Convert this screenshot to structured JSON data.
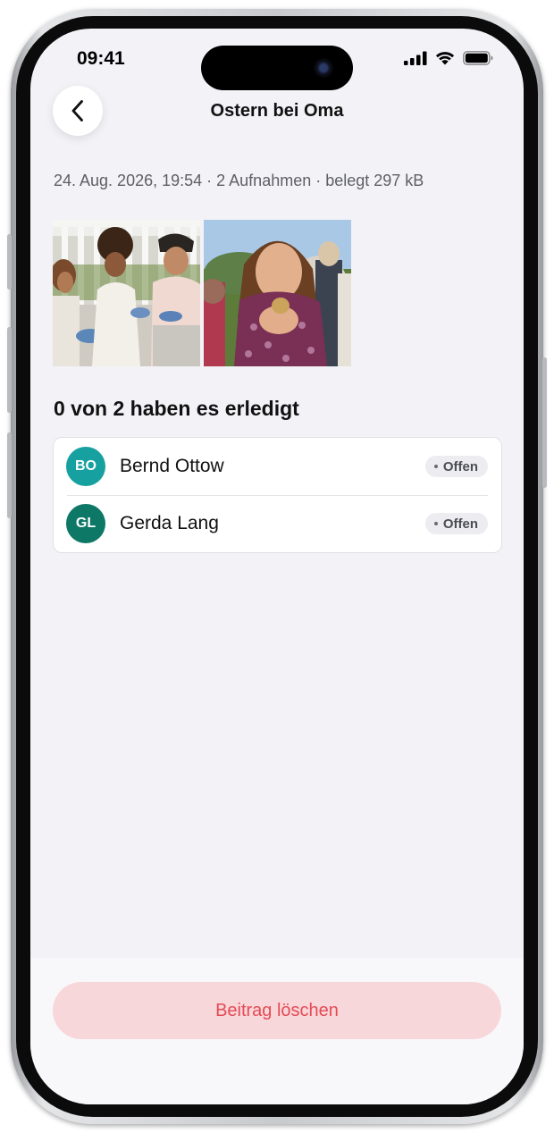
{
  "status_bar": {
    "time": "09:41"
  },
  "nav": {
    "title": "Ostern bei Oma"
  },
  "meta": {
    "text": "24. Aug. 2026, 19:54 · 2 Aufnahmen · belegt 297 kB"
  },
  "section": {
    "title": "0 von 2 haben es erledigt"
  },
  "people": [
    {
      "initials": "BO",
      "name": "Bernd Ottow",
      "status": "Offen",
      "color": "#17a0a0"
    },
    {
      "initials": "GL",
      "name": "Gerda Lang",
      "status": "Offen",
      "color": "#0e7866"
    }
  ],
  "actions": {
    "delete_label": "Beitrag löschen"
  },
  "colors": {
    "delete_bg": "#f8d7da",
    "delete_text": "#e44b55",
    "screen_bg": "#f3f2f7"
  }
}
